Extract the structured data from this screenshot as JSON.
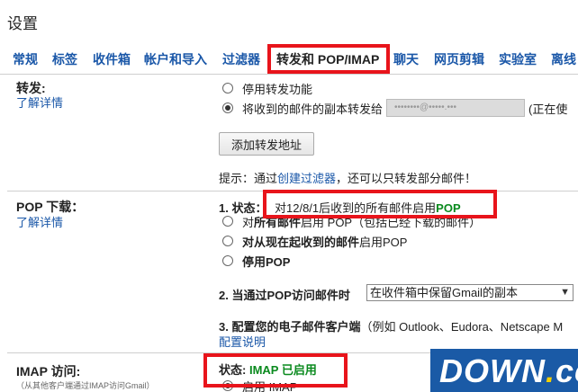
{
  "page_title": "设置",
  "tabs": [
    {
      "label": "常规"
    },
    {
      "label": "标签"
    },
    {
      "label": "收件箱"
    },
    {
      "label": "帐户和导入"
    },
    {
      "label": "过滤器"
    },
    {
      "label": "转发和 POP/IMAP",
      "active": true
    },
    {
      "label": "聊天"
    },
    {
      "label": "网页剪辑"
    },
    {
      "label": "实验室"
    },
    {
      "label": "离线"
    }
  ],
  "forwarding": {
    "title": "转发:",
    "learn_more": "了解详情",
    "option_disable": "停用转发功能",
    "option_forward_prefix": "将收到的邮件的副本转发给",
    "option_forward_suffix": "(正在使",
    "add_button": "添加转发地址",
    "hint_prefix": "提示：通过",
    "hint_link": "创建过滤器",
    "hint_suffix": "，还可以只转发部分邮件！"
  },
  "pop": {
    "title": "POP 下载：",
    "learn_more": "了解详情",
    "status_label": "1. 状态：",
    "status_text": "对12/8/1后收到的所有邮件启用",
    "status_highlight": "POP",
    "option_all_prefix": "对",
    "option_all_bold": "所有邮件",
    "option_all_suffix": "启用 POP（包括已经下载的邮件）",
    "option_new_bold": "对从现在起收到的邮件",
    "option_new_suffix": "启用POP",
    "option_disable": "停用POP",
    "when_label": "2. 当通过POP访问邮件时",
    "when_value": "在收件箱中保留Gmail的副本",
    "configure_label": "3. 配置您的电子邮件客户端",
    "configure_note": "（例如 Outlook、Eudora、Netscape M",
    "configure_link": "配置说明"
  },
  "imap": {
    "title": "IMAP 访问:",
    "note": "（从其他客户端通过IMAP访问Gmail）",
    "status_label": "状态:",
    "status_value": "IMAP 已启用",
    "option_enable": "启用 IMAP"
  },
  "watermark": {
    "text": "DOWN",
    "dot": ".",
    "suffix": "cc"
  },
  "colors": {
    "link": "#1a57a8",
    "highlight_border": "#e8141b",
    "enabled_green": "#0a8a1e",
    "watermark_bg": "#1a5aa6"
  }
}
